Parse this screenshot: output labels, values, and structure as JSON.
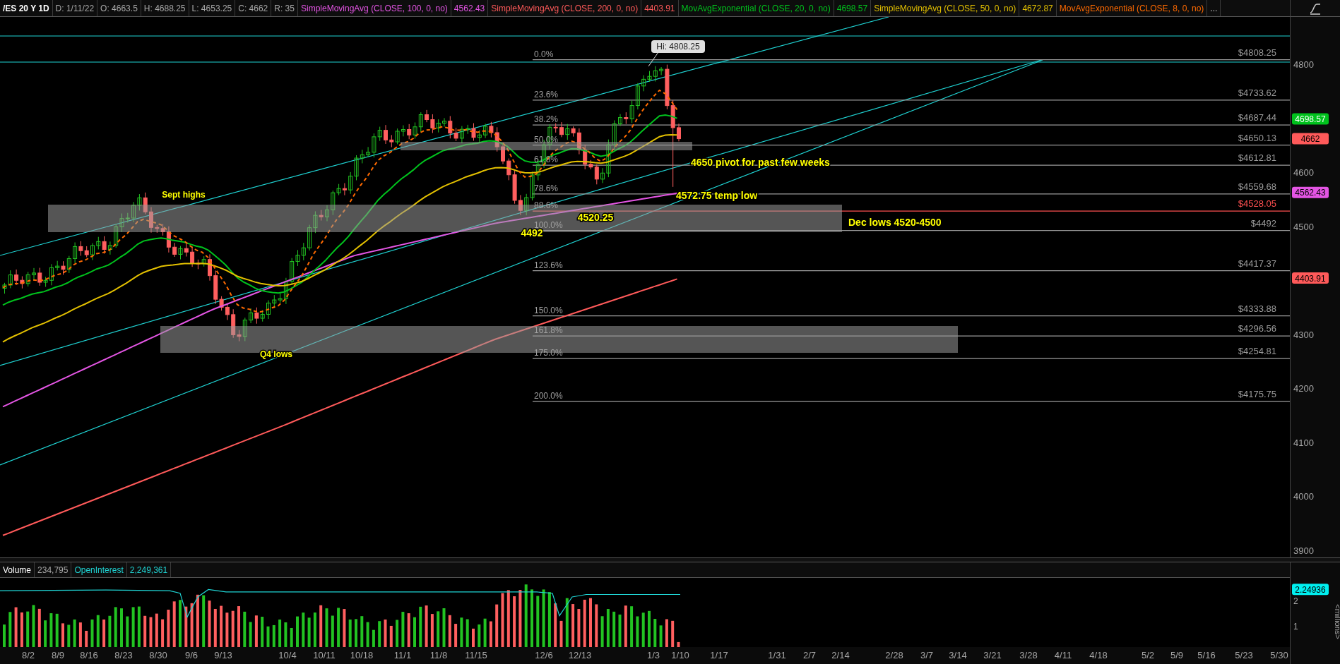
{
  "header": {
    "symbol": "/ES 20 Y 1D",
    "fields": [
      "D: 1/11/22",
      "O: 4663.5",
      "H: 4688.25",
      "L: 4653.25",
      "C: 4662",
      "R: 35"
    ],
    "studies": [
      {
        "name": "SimpleMovingAvg (CLOSE, 100, 0, no)",
        "value": "4562.43",
        "color": "#e455e4"
      },
      {
        "name": "SimpleMovingAvg (CLOSE, 200, 0, no)",
        "value": "4403.91",
        "color": "#ff5a5a"
      },
      {
        "name": "MovAvgExponential (CLOSE, 20, 0, no)",
        "value": "4698.57",
        "color": "#00c21d"
      },
      {
        "name": "SimpleMovingAvg (CLOSE, 50, 0, no)",
        "value": "4672.87",
        "color": "#e3c000"
      },
      {
        "name": "MovAvgExponential (CLOSE, 8, 0, no)",
        "color": "#ff6a00"
      }
    ],
    "more": "..."
  },
  "price_pane": {
    "high_label": "Hi: 4808.25",
    "fib_levels": [
      {
        "percent": "0.0%",
        "price": "$4808.25",
        "color": "#9a9a9a"
      },
      {
        "percent": "23.6%",
        "price": "$4733.62",
        "color": "#9a9a9a"
      },
      {
        "percent": "38.2%",
        "price": "$4687.44",
        "color": "#9a9a9a"
      },
      {
        "percent": "50.0%",
        "price": "$4650.13",
        "color": "#9a9a9a"
      },
      {
        "percent": "61.8%",
        "price": "$4612.81",
        "color": "#9a9a9a"
      },
      {
        "percent": "78.6%",
        "price": "$4559.68",
        "color": "#9a9a9a"
      },
      {
        "percent": "88.6%",
        "price": "$4528.05",
        "color": "#ff5050"
      },
      {
        "percent": "100.0%",
        "price": "$4492",
        "color": "#9a9a9a"
      },
      {
        "percent": "123.6%",
        "price": "$4417.37",
        "color": "#9a9a9a"
      },
      {
        "percent": "150.0%",
        "price": "$4333.88",
        "color": "#9a9a9a"
      },
      {
        "percent": "161.8%",
        "price": "$4296.56",
        "color": "#9a9a9a"
      },
      {
        "percent": "175.0%",
        "price": "$4254.81",
        "color": "#9a9a9a"
      },
      {
        "percent": "200.0%",
        "price": "$4175.75",
        "color": "#9a9a9a"
      }
    ],
    "annotations": [
      "Sept highs",
      "4650 pivot for past few weeks",
      "4572.75 temp low",
      "4520.25",
      "4492",
      "Dec lows 4520-4500",
      "Q4 lows"
    ]
  },
  "price_axis": {
    "ticks": [
      "4800",
      "4600",
      "4500",
      "4300",
      "4200",
      "4100",
      "4000",
      "3900"
    ],
    "badges": [
      {
        "value": "4698.57",
        "color": "#00c21d"
      },
      {
        "value": "4662",
        "color": "#ff5a5a"
      },
      {
        "value": "4562.43",
        "color": "#e455e4"
      },
      {
        "value": "4403.91",
        "color": "#ff5a5a"
      }
    ]
  },
  "volume_pane": {
    "title": "Volume",
    "volume": "234,795",
    "oi_label": "OpenInterest",
    "oi_value": "2,249,361",
    "ticks": [
      "2",
      "1"
    ],
    "badge": "2.24936",
    "unit": "<millions>"
  },
  "x_ticks": [
    "8/2",
    "8/9",
    "8/16",
    "8/23",
    "8/30",
    "9/6",
    "9/13",
    "10/4",
    "10/11",
    "10/18",
    "11/1",
    "11/8",
    "11/15",
    "12/6",
    "12/13",
    "1/3",
    "1/10",
    "1/17",
    "1/31",
    "2/7",
    "2/14",
    "2/28",
    "3/7",
    "3/14",
    "3/21",
    "3/28",
    "4/11",
    "4/18",
    "5/2",
    "5/9",
    "5/16",
    "5/23",
    "5/30"
  ]
}
